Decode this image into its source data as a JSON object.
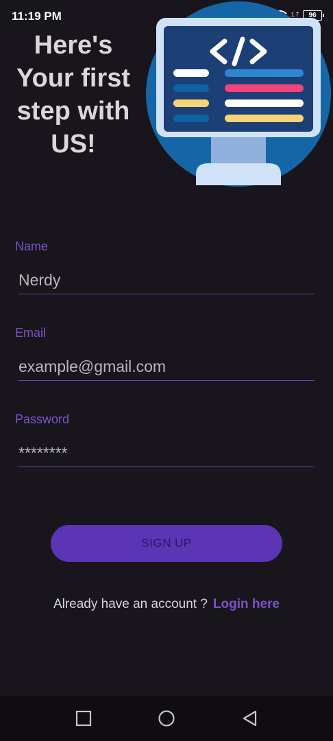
{
  "status_bar": {
    "time": "11:19 PM",
    "net_speed": "1.7",
    "battery": "96"
  },
  "header": {
    "headline": "Here's Your first step with US!",
    "illustration_icon": "code-monitor-icon"
  },
  "form": {
    "name": {
      "label": "Name",
      "value": "Nerdy"
    },
    "email": {
      "label": "Email",
      "value": "",
      "placeholder": "example@gmail.com"
    },
    "password": {
      "label": "Password",
      "value": "********"
    },
    "signup_label": "SIGN UP"
  },
  "footer": {
    "prompt": "Already have an account ?",
    "link": "Login here"
  },
  "nav": {
    "recent_icon": "square-icon",
    "home_icon": "circle-icon",
    "back_icon": "triangle-back-icon"
  },
  "colors": {
    "background": "#18151c",
    "accent": "#7b52c9",
    "button": "#5b35b5"
  }
}
